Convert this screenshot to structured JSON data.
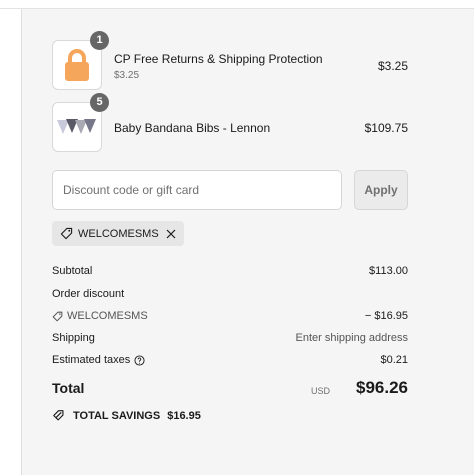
{
  "items": [
    {
      "quantity": "1",
      "title": "CP Free Returns & Shipping Protection",
      "subtitle": "$3.25",
      "price": "$3.25",
      "thumbnail_icon": "lock-icon"
    },
    {
      "quantity": "5",
      "title": "Baby Bandana Bibs - Lennon",
      "price": "$109.75",
      "thumbnail_icon": "bibs-product-image"
    }
  ],
  "discount": {
    "placeholder": "Discount code or gift card",
    "value": "",
    "apply_label": "Apply",
    "applied_code": "WELCOMESMS"
  },
  "summary": {
    "subtotal_label": "Subtotal",
    "subtotal_value": "$113.00",
    "order_discount_label": "Order discount",
    "discount_code": "WELCOMESMS",
    "discount_value": "− $16.95",
    "shipping_label": "Shipping",
    "shipping_value": "Enter shipping address",
    "taxes_label": "Estimated taxes",
    "taxes_value": "$0.21",
    "total_label": "Total",
    "currency": "USD",
    "total_value": "$96.26",
    "savings_label": "TOTAL SAVINGS",
    "savings_value": "$16.95"
  },
  "colors": {
    "summary_bg": "#f5f5f5",
    "lock_orange": "#f5a65b",
    "badge": "#666666"
  }
}
